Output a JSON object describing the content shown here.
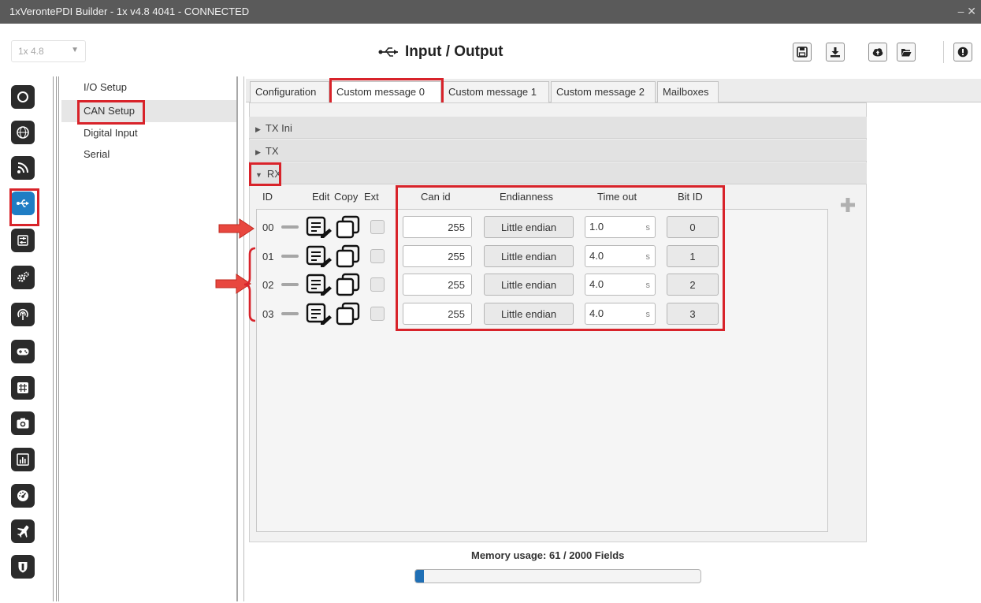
{
  "window": {
    "title": "1xVerontePDI Builder - 1x v4.8 4041 - CONNECTED",
    "controls": "– ✕"
  },
  "header": {
    "version_select": "1x 4.8",
    "page_title": "Input / Output",
    "page_icon": "usb-icon",
    "toolbar": [
      "save-icon",
      "download-icon",
      "cloud-upload-icon",
      "folder-open-icon",
      "info-icon"
    ]
  },
  "sidebar": {
    "icons": [
      "power-icon",
      "sphere-icon",
      "rss-icon",
      "usb-icon",
      "sliders-icon",
      "gears-icon",
      "podcast-icon",
      "gamepad-icon",
      "grid-icon",
      "camera-icon",
      "chart-icon",
      "dashboard-icon",
      "plane-icon",
      "shield-icon"
    ],
    "active_index": 3
  },
  "menu": {
    "items": [
      "I/O Setup",
      "CAN Setup",
      "Digital Input",
      "Serial"
    ],
    "active_index": 1
  },
  "tabs": {
    "items": [
      "Configuration",
      "Custom message 0",
      "Custom message 1",
      "Custom message 2",
      "Mailboxes"
    ],
    "active_index": 1
  },
  "sections": [
    {
      "label": "TX Ini",
      "expanded": false
    },
    {
      "label": "TX",
      "expanded": false
    },
    {
      "label": "RX",
      "expanded": true
    }
  ],
  "rx_table": {
    "columns": {
      "id": "ID",
      "edit": "Edit",
      "copy": "Copy",
      "ext": "Ext",
      "can_id": "Can id",
      "endianness": "Endianness",
      "timeout": "Time out",
      "bit_id": "Bit ID"
    },
    "rows": [
      {
        "id": "00",
        "can_id": "255",
        "endianness": "Little endian",
        "timeout": "1.0",
        "unit": "s",
        "bit_id": "0"
      },
      {
        "id": "01",
        "can_id": "255",
        "endianness": "Little endian",
        "timeout": "4.0",
        "unit": "s",
        "bit_id": "1"
      },
      {
        "id": "02",
        "can_id": "255",
        "endianness": "Little endian",
        "timeout": "4.0",
        "unit": "s",
        "bit_id": "2"
      },
      {
        "id": "03",
        "can_id": "255",
        "endianness": "Little endian",
        "timeout": "4.0",
        "unit": "s",
        "bit_id": "3"
      }
    ]
  },
  "memory": {
    "label": "Memory usage: 61 / 2000 Fields",
    "fraction": 0.0305
  },
  "colors": {
    "highlight": "#d8232a",
    "active_icon": "#1f7dc4",
    "arrow": "#e8473f",
    "progress": "#1f6fb5"
  }
}
